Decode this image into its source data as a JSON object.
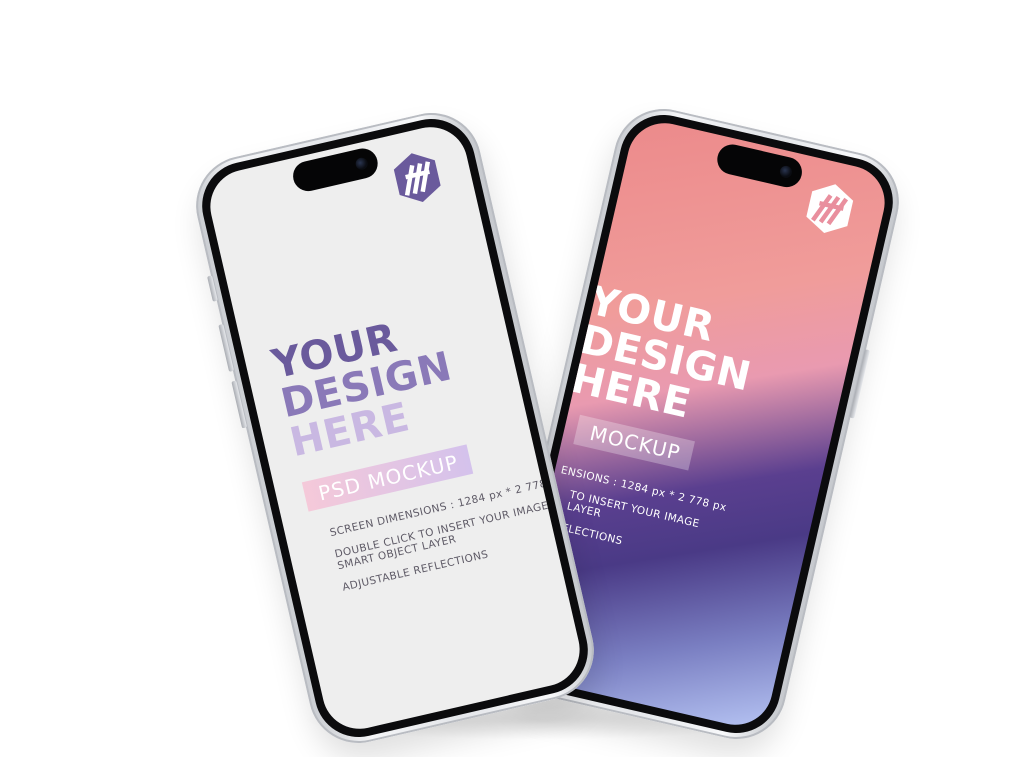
{
  "headline": {
    "line1": "YOUR",
    "line2": "DESIGN",
    "line3": "HERE"
  },
  "mockup_label": "PSD MOCKUP",
  "mockup_label_right_visible": "MOCKUP",
  "specs": {
    "dimensions": "SCREEN DIMENSIONS : 1284 px * 2 778 px",
    "insert_line1": "DOUBLE CLICK TO INSERT YOUR IMAGE",
    "insert_line2": "SMART OBJECT LAYER",
    "reflections": "ADJUSTABLE REFLECTIONS"
  },
  "specs_right_visible": {
    "dimensions": "ENSIONS : 1284 px * 2 778 px",
    "insert_line1": "TO INSERT YOUR IMAGE",
    "insert_line2": "LAYER",
    "reflections": "FLECTIONS"
  },
  "colors": {
    "left_screen_bg": "#eeeeee",
    "headline_purple": "#6a5a9c",
    "gradient_pink": "#ec8a8b",
    "gradient_purple": "#4a3a86",
    "gradient_blue": "#b7c5f4"
  },
  "icons": {
    "logo": "hexagon-monogram-logo-icon",
    "camera": "front-camera-icon"
  }
}
